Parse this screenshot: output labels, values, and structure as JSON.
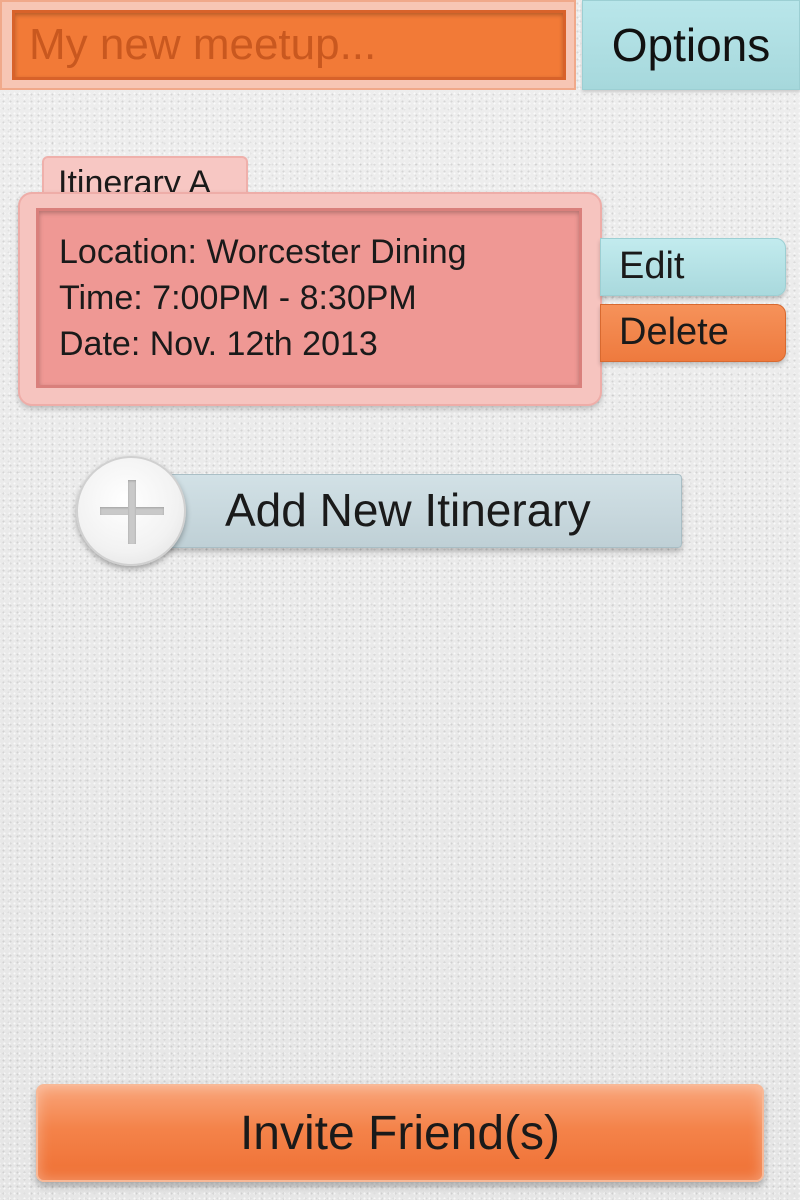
{
  "header": {
    "title_placeholder": "My new meetup...",
    "title_value": "",
    "options_label": "Options"
  },
  "itinerary": {
    "tab_label": "Itinerary A",
    "location_line": "Location: Worcester Dining",
    "time_line": "Time: 7:00PM - 8:30PM",
    "date_line": "Date: Nov. 12th 2013",
    "edit_label": "Edit",
    "delete_label": "Delete"
  },
  "add_itinerary": {
    "label": "Add New Itinerary",
    "icon": "plus-icon"
  },
  "footer": {
    "invite_label": "Invite Friend(s)"
  },
  "colors": {
    "accent_orange": "#f27a37",
    "accent_teal": "#a9d9dd",
    "card_pink": "#ef9894"
  }
}
